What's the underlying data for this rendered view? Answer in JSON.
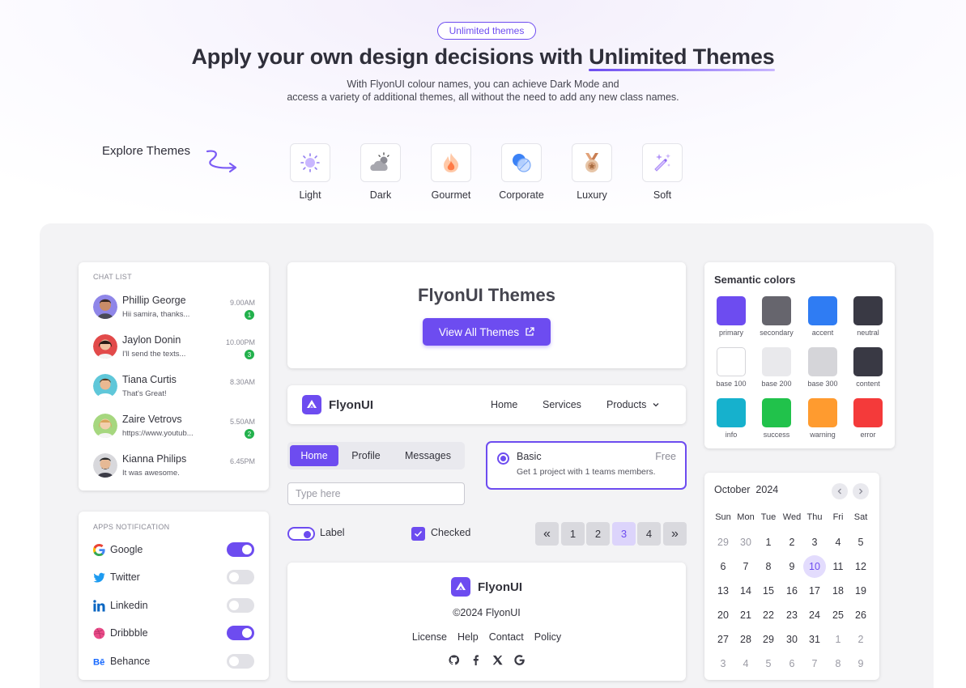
{
  "hero": {
    "badge": "Unlimited themes",
    "title_prefix": "Apply your own design decisions with ",
    "title_highlight": "Unlimited Themes",
    "subtitle_line1": "With FlyonUI colour names, you can achieve Dark Mode and",
    "subtitle_line2": "access a variety of additional themes, all without the need to add any new class names.",
    "explore_label": "Explore Themes"
  },
  "themes": [
    {
      "label": "Light",
      "icon": "sun-icon"
    },
    {
      "label": "Dark",
      "icon": "cloud-moon-icon"
    },
    {
      "label": "Gourmet",
      "icon": "flame-icon"
    },
    {
      "label": "Corporate",
      "icon": "globe-icon"
    },
    {
      "label": "Luxury",
      "icon": "medal-icon"
    },
    {
      "label": "Soft",
      "icon": "magic-wand-icon"
    }
  ],
  "chat_list": {
    "title": "CHAT LIST",
    "items": [
      {
        "name": "Phillip George",
        "message": "Hii samira, thanks...",
        "time": "9.00AM",
        "unread": "1"
      },
      {
        "name": "Jaylon Donin",
        "message": "I'll send the texts...",
        "time": "10.00PM",
        "unread": "3"
      },
      {
        "name": "Tiana Curtis",
        "message": "That's Great!",
        "time": "8.30AM",
        "unread": ""
      },
      {
        "name": "Zaire Vetrovs",
        "message": "https://www.youtub...",
        "time": "5.50AM",
        "unread": "2"
      },
      {
        "name": "Kianna Philips",
        "message": "It was awesome.",
        "time": "6.45PM",
        "unread": ""
      }
    ]
  },
  "apps": {
    "title": "APPS NOTIFICATION",
    "items": [
      {
        "name": "Google",
        "on": true
      },
      {
        "name": "Twitter",
        "on": false
      },
      {
        "name": "Linkedin",
        "on": false
      },
      {
        "name": "Dribbble",
        "on": true
      },
      {
        "name": "Behance",
        "on": false
      }
    ]
  },
  "themes_card": {
    "title": "FlyonUI Themes",
    "button": "View All Themes"
  },
  "navbar": {
    "brand": "FlyonUI",
    "links": [
      "Home",
      "Services",
      "Products"
    ]
  },
  "tabs": [
    "Home",
    "Profile",
    "Messages"
  ],
  "input": {
    "placeholder": "Type here"
  },
  "plan": {
    "name": "Basic",
    "price": "Free",
    "description": "Get 1 project with 1 teams members."
  },
  "toggle": {
    "label": "Label",
    "on": true
  },
  "checkbox": {
    "label": "Checked",
    "checked": true
  },
  "pagination": {
    "first": "«",
    "pages": [
      "1",
      "2",
      "3",
      "4"
    ],
    "last": "»",
    "active": "3"
  },
  "footer": {
    "brand": "FlyonUI",
    "copyright": "©2024 FlyonUI",
    "links": [
      "License",
      "Help",
      "Contact",
      "Policy"
    ],
    "socials": [
      "github-icon",
      "facebook-icon",
      "x-icon",
      "google-icon"
    ]
  },
  "semantic": {
    "title": "Semantic colors",
    "colors": [
      {
        "name": "primary",
        "hex": "#6d4cf0"
      },
      {
        "name": "secondary",
        "hex": "#66656d"
      },
      {
        "name": "accent",
        "hex": "#2f7cf3"
      },
      {
        "name": "neutral",
        "hex": "#393944"
      },
      {
        "name": "base 100",
        "hex": "#ffffff"
      },
      {
        "name": "base 200",
        "hex": "#e9e9ec"
      },
      {
        "name": "base 300",
        "hex": "#d5d5d9"
      },
      {
        "name": "content",
        "hex": "#393944"
      },
      {
        "name": "info",
        "hex": "#16b1cd"
      },
      {
        "name": "success",
        "hex": "#21c24b"
      },
      {
        "name": "warning",
        "hex": "#ff9b2f"
      },
      {
        "name": "error",
        "hex": "#f43a3a"
      }
    ]
  },
  "calendar": {
    "month": "October",
    "year": "2024",
    "weekdays": [
      "Sun",
      "Mon",
      "Tue",
      "Wed",
      "Thu",
      "Fri",
      "Sat"
    ],
    "weeks": [
      [
        "29",
        "30",
        "1",
        "2",
        "3",
        "4",
        "5"
      ],
      [
        "6",
        "7",
        "8",
        "9",
        "10",
        "11",
        "12"
      ],
      [
        "13",
        "14",
        "15",
        "16",
        "17",
        "18",
        "19"
      ],
      [
        "20",
        "21",
        "22",
        "23",
        "24",
        "25",
        "26"
      ],
      [
        "27",
        "28",
        "29",
        "30",
        "31",
        "1",
        "2"
      ],
      [
        "3",
        "4",
        "5",
        "6",
        "7",
        "8",
        "9"
      ]
    ],
    "selected": "10"
  }
}
